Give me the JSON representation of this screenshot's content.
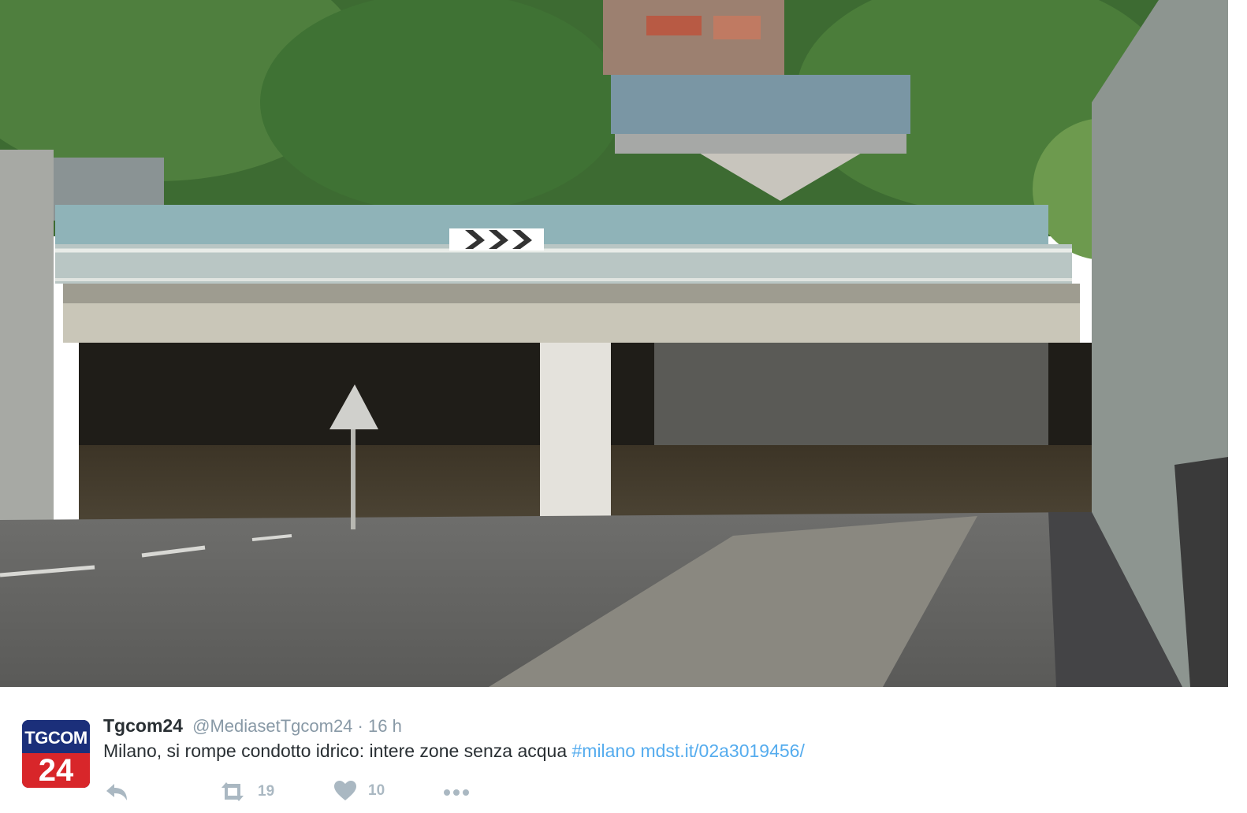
{
  "tweet": {
    "author_name": "Tgcom24",
    "handle": "@MediasetTgcom24",
    "separator": "·",
    "time": "16 h",
    "text": "Milano, si rompe condotto idrico: intere zone senza acqua",
    "hashtag": "#milano",
    "url": "mdst.it/02a3019456/"
  },
  "avatar": {
    "top_text": "TGCOM",
    "bottom_text": "24"
  },
  "actions": {
    "retweet_count": "19",
    "like_count": "10"
  },
  "colors": {
    "link": "#55acee",
    "muted": "#8899a6",
    "text": "#292f33",
    "icon": "#aab8c2"
  }
}
